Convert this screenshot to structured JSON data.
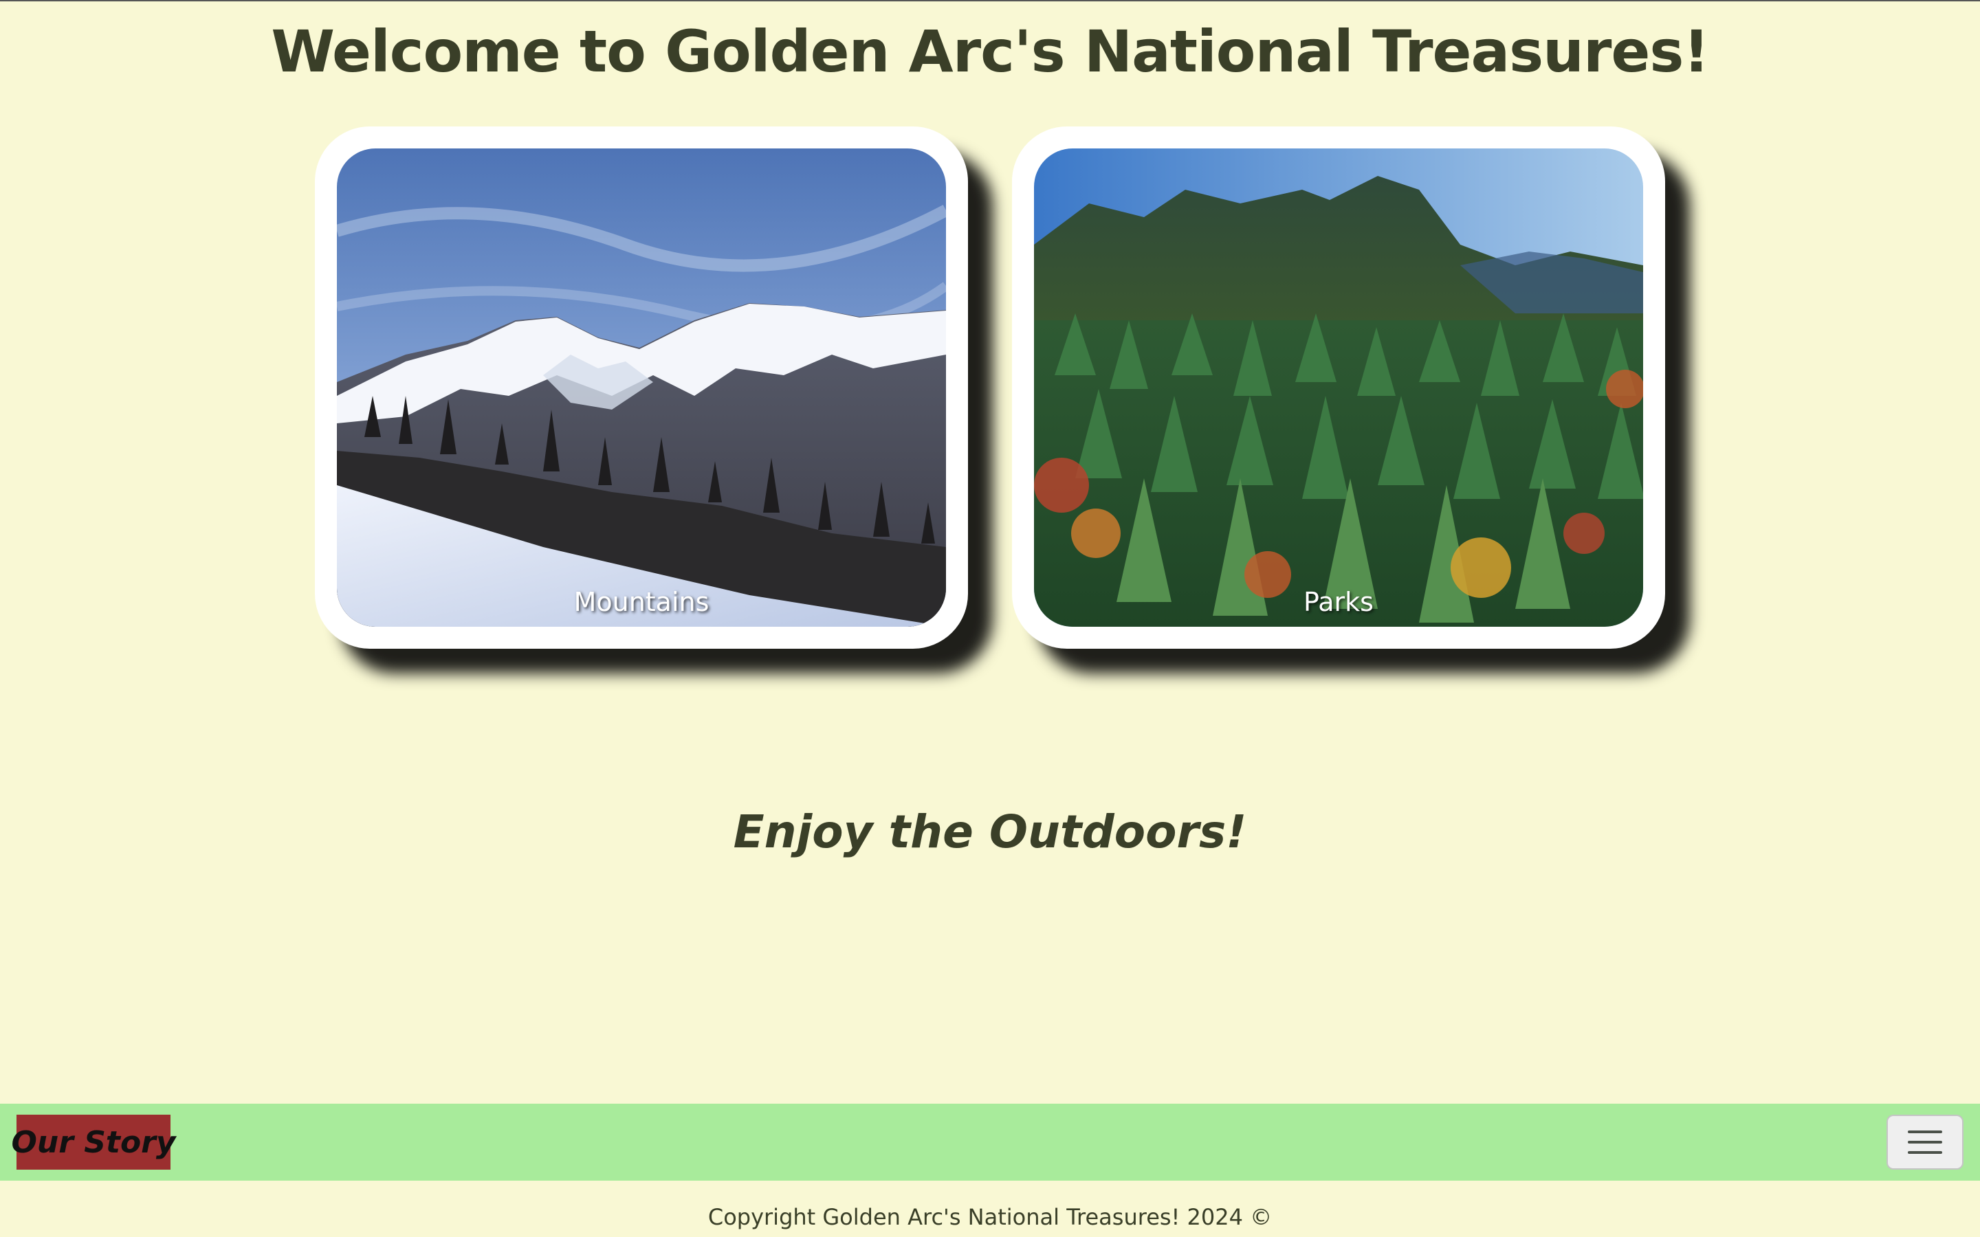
{
  "header": {
    "title": "Welcome to Golden Arc's National Treasures!"
  },
  "cards": [
    {
      "label": "Mountains",
      "image": "snowy-mountain-photo"
    },
    {
      "label": "Parks",
      "image": "forest-valley-photo"
    }
  ],
  "tagline": "Enjoy the Outdoors!",
  "navbar": {
    "brand": "Our Story",
    "toggler_icon": "hamburger-menu-icon"
  },
  "footer": {
    "copyright": "Copyright Golden Arc's National Treasures! 2024 ©"
  },
  "colors": {
    "background": "#f9f8d4",
    "navbar": "#a8eb9b",
    "brand": "#9b2f2f",
    "heading": "#3a3f28"
  }
}
